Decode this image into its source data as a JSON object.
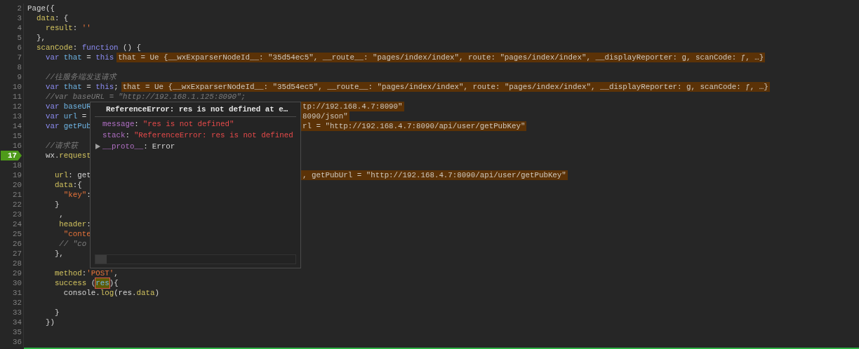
{
  "editor": {
    "lines_top": [
      {
        "number": "2",
        "current": false,
        "tokens": [
          {
            "kind": "plain",
            "text": "Page({"
          }
        ]
      },
      {
        "number": "3",
        "current": false,
        "tokens": [
          {
            "kind": "prop",
            "text": "  data"
          },
          {
            "kind": "plain",
            "text": ": {"
          }
        ]
      },
      {
        "number": "4",
        "current": false,
        "tokens": [
          {
            "kind": "prop",
            "text": "    result"
          },
          {
            "kind": "plain",
            "text": ": "
          },
          {
            "kind": "string",
            "text": "''"
          }
        ]
      },
      {
        "number": "5",
        "current": false,
        "tokens": [
          {
            "kind": "plain",
            "text": "  },"
          }
        ]
      },
      {
        "number": "6",
        "current": false,
        "tokens": [
          {
            "kind": "prop",
            "text": "  scanCode"
          },
          {
            "kind": "plain",
            "text": ": "
          },
          {
            "kind": "keyword",
            "text": "function"
          },
          {
            "kind": "plain",
            "text": " () {"
          }
        ]
      },
      {
        "number": "7",
        "current": false,
        "tokens": [
          {
            "kind": "keyword",
            "text": "    var"
          },
          {
            "kind": "ident",
            "text": " that"
          },
          {
            "kind": "plain",
            "text": " = "
          },
          {
            "kind": "keyword",
            "text": "this"
          },
          {
            "kind": "value",
            "text": "that = Ue {__wxExparserNodeId__: \"35d54ec5\", __route__: \"pages/index/index\", route: \"pages/index/index\", __displayReporter: g, scanCode: ƒ, …}"
          }
        ]
      },
      {
        "number": "8",
        "current": false
      },
      {
        "number": "9",
        "current": false,
        "tokens": [
          {
            "kind": "comment",
            "text": "    //往服务端发送请求"
          }
        ]
      },
      {
        "number": "10",
        "current": false,
        "tokens": [
          {
            "kind": "keyword",
            "text": "    var"
          },
          {
            "kind": "ident",
            "text": " that"
          },
          {
            "kind": "plain",
            "text": " = "
          },
          {
            "kind": "keyword",
            "text": "this"
          },
          {
            "kind": "plain",
            "text": ";"
          },
          {
            "kind": "value",
            "text": "that = Ue {__wxExparserNodeId__: \"35d54ec5\", __route__: \"pages/index/index\", route: \"pages/index/index\", __displayReporter: g, scanCode: ƒ, …}"
          }
        ]
      },
      {
        "number": "11",
        "current": false,
        "tokens": [
          {
            "kind": "comment",
            "text": "    //var baseURL = \"http://192.168.1.125:8090\";"
          }
        ]
      }
    ],
    "lines_beside_popup": [
      {
        "number": "12",
        "current": false,
        "tokens": [
          {
            "kind": "keyword",
            "text": "    var"
          },
          {
            "kind": "ident",
            "text": " baseUR"
          }
        ],
        "right_tokens": [
          {
            "kind": "value",
            "text": "tp://192.168.4.7:8090\""
          }
        ]
      },
      {
        "number": "13",
        "current": false,
        "tokens": [
          {
            "kind": "keyword",
            "text": "    var"
          },
          {
            "kind": "ident",
            "text": " url"
          },
          {
            "kind": "plain",
            "text": " ="
          }
        ],
        "right_tokens": [
          {
            "kind": "value",
            "text": "8090/json\""
          }
        ]
      },
      {
        "number": "14",
        "current": false,
        "tokens": [
          {
            "kind": "keyword",
            "text": "    var"
          },
          {
            "kind": "ident",
            "text": " getPub"
          }
        ],
        "right_tokens": [
          {
            "kind": "value",
            "text": "rl = \"http://192.168.4.7:8090/api/user/getPubKey\""
          }
        ]
      },
      {
        "number": "15",
        "current": false
      },
      {
        "number": "16",
        "current": false,
        "tokens": [
          {
            "kind": "comment",
            "text": "    //请求获"
          }
        ]
      },
      {
        "number": "17",
        "current": true,
        "tokens": [
          {
            "kind": "plain",
            "text": "    wx."
          },
          {
            "kind": "prop",
            "text": "request"
          }
        ]
      },
      {
        "number": "18",
        "current": false
      },
      {
        "number": "19",
        "current": false,
        "tokens": [
          {
            "kind": "prop",
            "text": "      url"
          },
          {
            "kind": "plain",
            "text": ": get"
          }
        ],
        "right_tokens": [
          {
            "kind": "value",
            "text": ", getPubUrl = \"http://192.168.4.7:8090/api/user/getPubKey\""
          }
        ]
      },
      {
        "number": "20",
        "current": false,
        "tokens": [
          {
            "kind": "prop",
            "text": "      data"
          },
          {
            "kind": "plain",
            "text": ":{"
          }
        ]
      },
      {
        "number": "21",
        "current": false,
        "tokens": [
          {
            "kind": "string",
            "text": "        \"key\""
          },
          {
            "kind": "plain",
            "text": ":"
          }
        ]
      },
      {
        "number": "22",
        "current": false,
        "tokens": [
          {
            "kind": "plain",
            "text": "      }"
          }
        ]
      },
      {
        "number": "23",
        "current": false,
        "tokens": [
          {
            "kind": "plain",
            "text": "       ,"
          }
        ]
      },
      {
        "number": "24",
        "current": false,
        "tokens": [
          {
            "kind": "prop",
            "text": "       header"
          },
          {
            "kind": "plain",
            "text": ":"
          }
        ]
      },
      {
        "number": "25",
        "current": false,
        "tokens": [
          {
            "kind": "string",
            "text": "        \"conte"
          }
        ]
      },
      {
        "number": "26",
        "current": false,
        "tokens": [
          {
            "kind": "comment",
            "text": "       // \"co"
          }
        ]
      },
      {
        "number": "27",
        "current": false,
        "tokens": [
          {
            "kind": "plain",
            "text": "      },"
          }
        ]
      },
      {
        "number": "28",
        "current": false
      }
    ],
    "lines_bottom": [
      {
        "number": "29",
        "current": false,
        "tokens": [
          {
            "kind": "prop",
            "text": "      method"
          },
          {
            "kind": "plain",
            "text": ":"
          },
          {
            "kind": "string",
            "text": "'POST'"
          },
          {
            "kind": "plain",
            "text": ","
          }
        ]
      },
      {
        "number": "30",
        "current": false,
        "tokens": [
          {
            "kind": "prop",
            "text": "      success"
          },
          {
            "kind": "plain",
            "text": " ("
          },
          {
            "kind": "match",
            "text": "res"
          },
          {
            "kind": "plain",
            "text": "){"
          }
        ]
      },
      {
        "number": "31",
        "current": false,
        "tokens": [
          {
            "kind": "plain",
            "text": "        console."
          },
          {
            "kind": "prop",
            "text": "log"
          },
          {
            "kind": "plain",
            "text": "(res."
          },
          {
            "kind": "prop",
            "text": "data"
          },
          {
            "kind": "plain",
            "text": ")"
          }
        ]
      },
      {
        "number": "32",
        "current": false
      },
      {
        "number": "33",
        "current": false,
        "tokens": [
          {
            "kind": "plain",
            "text": "      }"
          }
        ]
      },
      {
        "number": "34",
        "current": false,
        "tokens": [
          {
            "kind": "plain",
            "text": "    })"
          }
        ]
      },
      {
        "number": "35",
        "current": false
      },
      {
        "number": "36",
        "current": false
      }
    ],
    "popup": {
      "title": "ReferenceError: res is not defined at e…",
      "properties": [
        {
          "key": "message",
          "separator": ":",
          "value": "\"res is not defined\""
        },
        {
          "key": "stack",
          "separator": ":",
          "value": "\"ReferenceError: res is not defined"
        }
      ],
      "proto": {
        "key": "__proto__",
        "separator": ":",
        "value": "Error",
        "expanded": false
      }
    }
  }
}
